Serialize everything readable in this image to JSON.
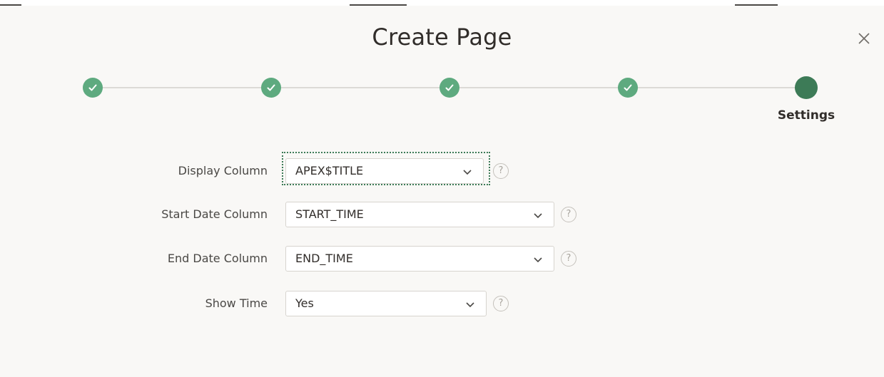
{
  "dialog": {
    "title": "Create Page",
    "close_icon": "close-icon"
  },
  "wizard": {
    "steps": [
      {
        "status": "complete",
        "icon": "check-icon"
      },
      {
        "status": "complete",
        "icon": "check-icon"
      },
      {
        "status": "complete",
        "icon": "check-icon"
      },
      {
        "status": "complete",
        "icon": "check-icon"
      },
      {
        "status": "current",
        "label": "Settings"
      }
    ],
    "complete_color": "#5eaa7f",
    "current_color": "#3d7b57"
  },
  "form": {
    "display_column": {
      "label": "Display Column",
      "value": "APEX$TITLE",
      "help": "?"
    },
    "start_date_column": {
      "label": "Start Date Column",
      "value": "START_TIME",
      "help": "?"
    },
    "end_date_column": {
      "label": "End Date Column",
      "value": "END_TIME",
      "help": "?"
    },
    "show_time": {
      "label": "Show Time",
      "value": "Yes",
      "help": "?"
    }
  }
}
